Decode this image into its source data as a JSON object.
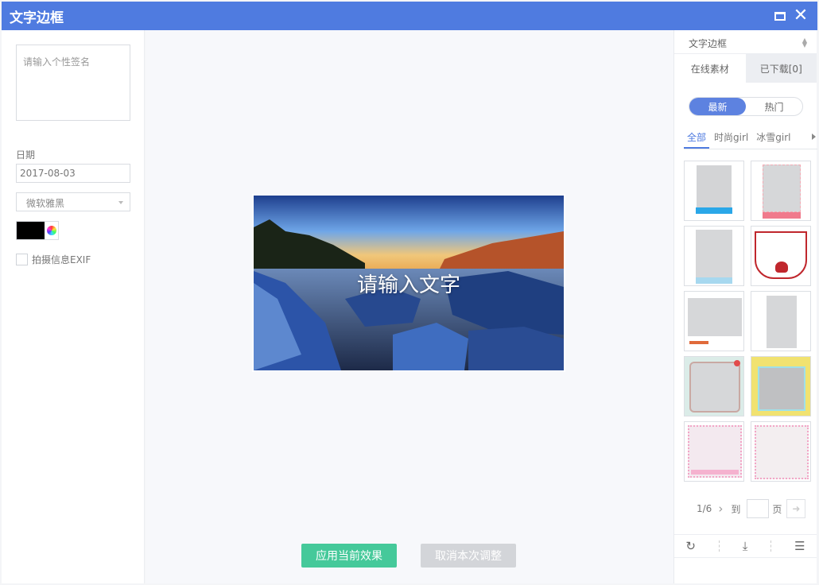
{
  "window": {
    "title": "文字边框"
  },
  "left": {
    "signature_placeholder": "请输入个性签名",
    "date_label": "日期",
    "date_value": "2017-08-03",
    "font_value": "微软雅黑",
    "text_color": "#000000",
    "exif_label": "拍摄信息EXIF"
  },
  "canvas": {
    "overlay_text": "请输入文字",
    "apply_label": "应用当前效果",
    "cancel_label": "取消本次调整"
  },
  "right": {
    "category_select": "文字边框",
    "tabs": [
      {
        "label": "在线素材",
        "active": true
      },
      {
        "label": "已下载[0]",
        "active": false
      }
    ],
    "sort": [
      {
        "label": "最新",
        "active": true
      },
      {
        "label": "热门",
        "active": false
      }
    ],
    "categories": [
      {
        "label": "全部",
        "active": true
      },
      {
        "label": "时尚girl",
        "active": false
      },
      {
        "label": "冰雪girl",
        "active": false
      }
    ],
    "pager": {
      "page_info": "1/6",
      "goto_label": "到",
      "page_suffix": "页"
    }
  },
  "colors": {
    "titlebar": "#4f7be0",
    "accent": "#5d82e0",
    "apply_button": "#45c99a",
    "cancel_button": "#d3d5d9"
  }
}
